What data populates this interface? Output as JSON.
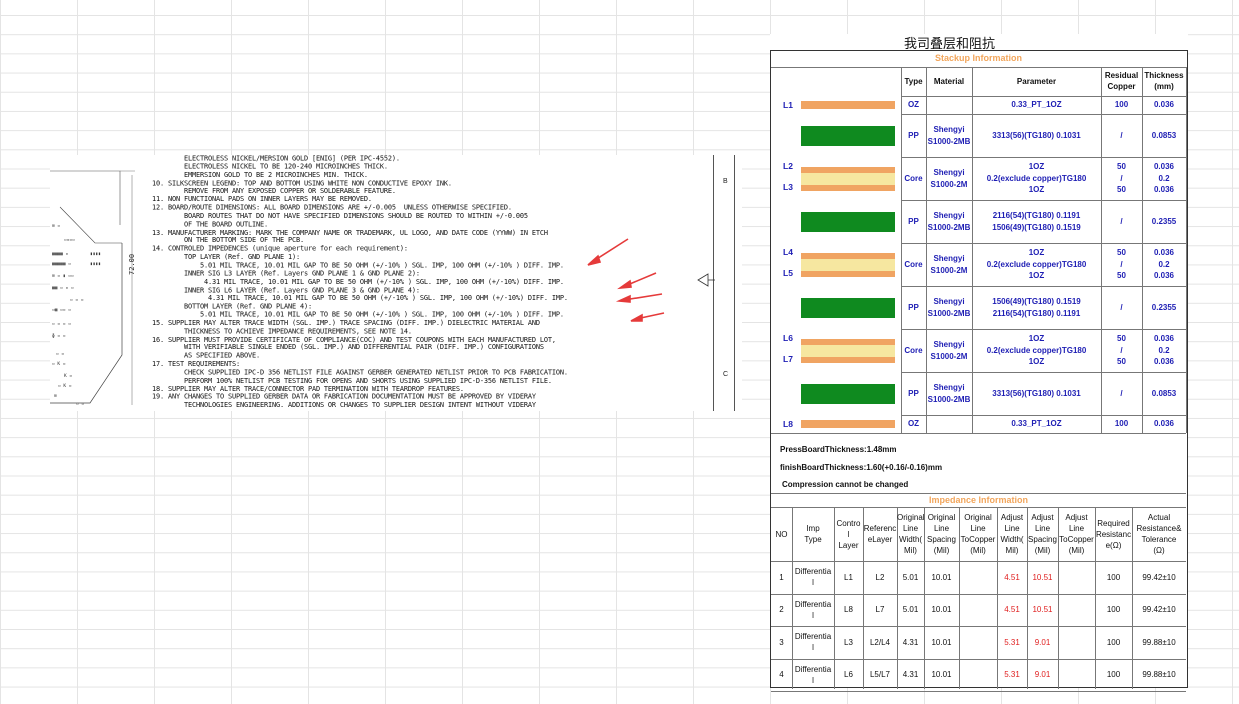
{
  "notes": {
    "lines": [
      "        ELECTROLESS NICKEL/MERSION GOLD [ENIG] (PER IPC-4552).",
      "        ELECTROLESS NICKEL TO BE 120-240 MICROINCHES THICK.",
      "        EMMERSION GOLD TO BE 2 MICROINCHES MIN. THICK.",
      "10. SILKSCREEN LEGEND: TOP AND BOTTOM USING WHITE NON CONDUCTIVE EPOXY INK.",
      "        REMOVE FROM ANY EXPOSED COPPER OR SOLDERABLE FEATURE.",
      "11. NON FUNCTIONAL PADS ON INNER LAYERS MAY BE REMOVED.",
      "12. BOARD/ROUTE DIMENSIONS: ALL BOARD DIMENSIONS ARE +/-0.005  UNLESS OTHERWISE SPECIFIED.",
      "        BOARD ROUTES THAT DO NOT HAVE SPECIFIED DIMENSIONS SHOULD BE ROUTED TO WITHIN +/-0.005",
      "        OF THE BOARD OUTLINE.",
      "13. MANUFACTURER MARKING: MARK THE COMPANY NAME OR TRADEMARK, UL LOGO, AND DATE CODE (YYWW) IN ETCH",
      "        ON THE BOTTOM SIDE OF THE PCB.",
      "14. CONTROLED IMPEDENCES (unique aperture for each requirement):",
      "        TOP LAYER (Ref. GND PLANE 1):",
      "            5.01 MIL TRACE, 10.01 MIL GAP TO BE 50 OHM (+/-10% ) SGL. IMP, 100 OHM (+/-10% ) DIFF. IMP.",
      "        INNER SIG L3 LAYER (Ref. Layers GND PLANE 1 & GND PLANE 2):",
      "             4.31 MIL TRACE, 10.01 MIL GAP TO BE 50 OHM (+/-10% ) SGL. IMP, 100 OHM (+/-10%) DIFF. IMP.",
      "        INNER SIG L6 LAYER (Ref. Layers GND PLANE 3 & GND PLANE 4):",
      "              4.31 MIL TRACE, 10.01 MIL GAP TO BE 50 OHM (+/-10% ) SGL. IMP, 100 OHM (+/-10%) DIFF. IMP.",
      "        BOTTOM LAYER (Ref. GND PLANE 4):",
      "            5.01 MIL TRACE, 10.01 MIL GAP TO BE 50 OHM (+/-10% ) SGL. IMP, 100 OHM (+/-10% ) DIFF. IMP.",
      "15. SUPPLIER MAY ALTER TRACE WIDTH (SGL. IMP.) TRACE SPACING (DIFF. IMP.) DIELECTRIC MATERIAL AND",
      "        THICKNESS TO ACHIEVE IMPEDANCE REQUIREMENTS, SEE NOTE 14.",
      "16. SUPPLIER MUST PROVIDE CERTIFICATE OF COMPLIANCE(COC) AND TEST COUPONS WITH EACH MANUFACTURED LOT,",
      "        WITH VERIFIABLE SINGLE ENDED (SGL. IMP.) AND DIFFERENTIAL PAIR (DIFF. IMP.) CONFIGURATIONS",
      "        AS SPECIFIED ABOVE.",
      "17. TEST REQUIREMENTS:",
      "        CHECK SUPPLIED IPC-D 356 NETLIST FILE AGAINST GERBER GENERATED NETLIST PRIOR TO PCB FABRICATION.",
      "        PERFORM 100% NETLIST PCB TESTING FOR OPENS AND SHORTS USING SUPPLIED IPC-D-356 NETLIST FILE.",
      "18. SUPPLIER MAY ALTER TRACE/CONNECTOR PAD TERMINATION WITH TEARDROP FEATURES.",
      "19. ANY CHANGES TO SUPPLIED GERBER DATA OR FABRICATION DOCUMENTATION MUST BE APPROVED BY VIDERAY",
      "        TECHNOLOGIES ENGINEERING. ADDITIONS OR CHANGES TO SUPPLIER DESIGN INTENT WITHOUT VIDERAY"
    ],
    "dimension": "72.00",
    "edge_letters": [
      "B",
      "C"
    ]
  },
  "stackup": {
    "caption": "我司叠层和阻抗",
    "title": "Stackup Information",
    "headers": [
      "Type",
      "Material",
      "Parameter",
      "Residual Copper",
      "Thickness (mm)"
    ],
    "layer_labels": [
      "L1",
      "L2",
      "L3",
      "L4",
      "L5",
      "L6",
      "L7",
      "L8"
    ],
    "rows": [
      {
        "type": "OZ",
        "material": "",
        "param": [
          "0.33_PT_1OZ"
        ],
        "copper": [
          "100"
        ],
        "thick": [
          "0.036"
        ]
      },
      {
        "type": "PP",
        "material": "Shengyi S1000-2MB",
        "param": [
          "3313(56)(TG180) 0.1031"
        ],
        "copper": [
          "/"
        ],
        "thick": [
          "0.0853"
        ]
      },
      {
        "type": "Core",
        "material": "Shengyi S1000-2M",
        "param": [
          "1OZ",
          "0.2(exclude copper)TG180",
          "1OZ"
        ],
        "copper": [
          "50",
          "/",
          "50"
        ],
        "thick": [
          "0.036",
          "0.2",
          "0.036"
        ]
      },
      {
        "type": "PP",
        "material": "Shengyi S1000-2MB",
        "param": [
          "2116(54)(TG180) 0.1191",
          "1506(49)(TG180) 0.1519"
        ],
        "copper": [
          "/"
        ],
        "thick": [
          "0.2355"
        ]
      },
      {
        "type": "Core",
        "material": "Shengyi S1000-2M",
        "param": [
          "1OZ",
          "0.2(exclude copper)TG180",
          "1OZ"
        ],
        "copper": [
          "50",
          "/",
          "50"
        ],
        "thick": [
          "0.036",
          "0.2",
          "0.036"
        ]
      },
      {
        "type": "PP",
        "material": "Shengyi S1000-2MB",
        "param": [
          "1506(49)(TG180) 0.1519",
          "2116(54)(TG180) 0.1191"
        ],
        "copper": [
          "/"
        ],
        "thick": [
          "0.2355"
        ]
      },
      {
        "type": "Core",
        "material": "Shengyi S1000-2M",
        "param": [
          "1OZ",
          "0.2(exclude copper)TG180",
          "1OZ"
        ],
        "copper": [
          "50",
          "/",
          "50"
        ],
        "thick": [
          "0.036",
          "0.2",
          "0.036"
        ]
      },
      {
        "type": "PP",
        "material": "Shengyi S1000-2MB",
        "param": [
          "3313(56)(TG180) 0.1031"
        ],
        "copper": [
          "/"
        ],
        "thick": [
          "0.0853"
        ]
      },
      {
        "type": "OZ",
        "material": "",
        "param": [
          "0.33_PT_1OZ"
        ],
        "copper": [
          "100"
        ],
        "thick": [
          "0.036"
        ]
      }
    ],
    "press_thickness": "PressBoardThickness:1.48mm",
    "finish_thickness": "finishBoardThickness:1.60(+0.16/-0.16)mm",
    "compression_note": "Compression cannot be changed"
  },
  "impedance": {
    "title": "Impedance Information",
    "headers": [
      "NO",
      "Imp Type",
      "Contro l Layer",
      "Referenc eLayer",
      "Original Line Width( Mil)",
      "Original Line Spacing (Mil)",
      "Original Line ToCopper (Mil)",
      "Adjust Line Width( Mil)",
      "Adjust Line Spacing (Mil)",
      "Adjust Line ToCopper (Mil)",
      "Required Resistanc e(Ω)",
      "Actual Resistance& Tolerance (Ω)"
    ],
    "rows": [
      {
        "no": "1",
        "type": "Differentia l",
        "ctrl": "L1",
        "ref": "L2",
        "ow": "5.01",
        "os": "10.01",
        "oc": "",
        "aw": "4.51",
        "as": "10.51",
        "ac": "",
        "req": "100",
        "act": "99.42±10"
      },
      {
        "no": "2",
        "type": "Differentia l",
        "ctrl": "L8",
        "ref": "L7",
        "ow": "5.01",
        "os": "10.01",
        "oc": "",
        "aw": "4.51",
        "as": "10.51",
        "ac": "",
        "req": "100",
        "act": "99.42±10"
      },
      {
        "no": "3",
        "type": "Differentia l",
        "ctrl": "L3",
        "ref": "L2/L4",
        "ow": "4.31",
        "os": "10.01",
        "oc": "",
        "aw": "5.31",
        "as": "9.01",
        "ac": "",
        "req": "100",
        "act": "99.88±10"
      },
      {
        "no": "4",
        "type": "Differentia l",
        "ctrl": "L6",
        "ref": "L5/L7",
        "ow": "4.31",
        "os": "10.01",
        "oc": "",
        "aw": "5.31",
        "as": "9.01",
        "ac": "",
        "req": "100",
        "act": "99.88±10"
      }
    ]
  },
  "colors": {
    "copper": "#f0a462",
    "prepreg": "#0f8a1f",
    "core": "#f6e7a0",
    "blue_text": "#1e1eb4",
    "title_orange": "#f2a65c",
    "adjusted_red": "#e02020",
    "annotation_arrow": "#e53a3a"
  }
}
